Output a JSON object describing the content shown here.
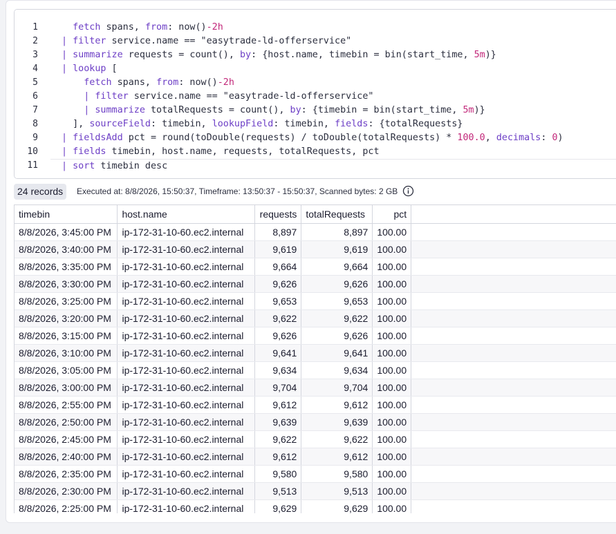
{
  "editor": {
    "lines": [
      {
        "n": "1",
        "tokens": [
          [
            "",
            "  "
          ],
          [
            "kw",
            "fetch"
          ],
          [
            "",
            " spans, "
          ],
          [
            "param",
            "from"
          ],
          [
            "",
            ": now()"
          ],
          [
            "num",
            "-2h"
          ]
        ]
      },
      {
        "n": "2",
        "tokens": [
          [
            "pipe",
            "| "
          ],
          [
            "kw",
            "filter"
          ],
          [
            "",
            " service.name == \"easytrade-ld-offerservice\""
          ]
        ]
      },
      {
        "n": "3",
        "tokens": [
          [
            "pipe",
            "| "
          ],
          [
            "kw",
            "summarize"
          ],
          [
            "",
            " requests = count(), "
          ],
          [
            "param",
            "by"
          ],
          [
            "",
            ": {host.name, timebin = bin(start_time, "
          ],
          [
            "num",
            "5m"
          ],
          [
            "",
            ")}"
          ]
        ]
      },
      {
        "n": "4",
        "tokens": [
          [
            "pipe",
            "| "
          ],
          [
            "kw",
            "lookup"
          ],
          [
            "",
            " ["
          ]
        ]
      },
      {
        "n": "5",
        "tokens": [
          [
            "",
            "    "
          ],
          [
            "kw",
            "fetch"
          ],
          [
            "",
            " spans, "
          ],
          [
            "param",
            "from"
          ],
          [
            "",
            ": now()"
          ],
          [
            "num",
            "-2h"
          ]
        ]
      },
      {
        "n": "6",
        "tokens": [
          [
            "",
            "    "
          ],
          [
            "pipe",
            "| "
          ],
          [
            "kw",
            "filter"
          ],
          [
            "",
            " service.name == \"easytrade-ld-offerservice\""
          ]
        ]
      },
      {
        "n": "7",
        "tokens": [
          [
            "",
            "    "
          ],
          [
            "pipe",
            "| "
          ],
          [
            "kw",
            "summarize"
          ],
          [
            "",
            " totalRequests = count(), "
          ],
          [
            "param",
            "by"
          ],
          [
            "",
            ": {timebin = bin(start_time, "
          ],
          [
            "num",
            "5m"
          ],
          [
            "",
            ")}"
          ]
        ]
      },
      {
        "n": "8",
        "tokens": [
          [
            "",
            "  ], "
          ],
          [
            "param",
            "sourceField"
          ],
          [
            "",
            ": timebin, "
          ],
          [
            "param",
            "lookupField"
          ],
          [
            "",
            ": timebin, "
          ],
          [
            "param",
            "fields"
          ],
          [
            "",
            ": {totalRequests}"
          ]
        ]
      },
      {
        "n": "9",
        "tokens": [
          [
            "pipe",
            "| "
          ],
          [
            "kw",
            "fieldsAdd"
          ],
          [
            "",
            " pct = round(toDouble(requests) / toDouble(totalRequests) * "
          ],
          [
            "num",
            "100.0"
          ],
          [
            "",
            ", "
          ],
          [
            "param",
            "decimals"
          ],
          [
            "",
            ": "
          ],
          [
            "num",
            "0"
          ],
          [
            "",
            ")"
          ]
        ]
      },
      {
        "n": "10",
        "tokens": [
          [
            "pipe",
            "| "
          ],
          [
            "kw",
            "fields"
          ],
          [
            "",
            " timebin, host.name, requests, totalRequests, pct"
          ]
        ]
      },
      {
        "n": "11",
        "tokens": [
          [
            "pipe",
            "| "
          ],
          [
            "kw",
            "sort"
          ],
          [
            "",
            " timebin desc"
          ]
        ]
      }
    ]
  },
  "status": {
    "records": "24 records",
    "meta": "Executed at: 8/8/2026, 15:50:37, Timeframe: 13:50:37 - 15:50:37, Scanned bytes: 2 GB",
    "info_icon": "info-icon"
  },
  "table": {
    "columns": [
      "timebin",
      "host.name",
      "requests",
      "totalRequests",
      "pct"
    ],
    "rows": [
      [
        "8/8/2026, 3:45:00 PM",
        "ip-172-31-10-60.ec2.internal",
        "8,897",
        "8,897",
        "100.00"
      ],
      [
        "8/8/2026, 3:40:00 PM",
        "ip-172-31-10-60.ec2.internal",
        "9,619",
        "9,619",
        "100.00"
      ],
      [
        "8/8/2026, 3:35:00 PM",
        "ip-172-31-10-60.ec2.internal",
        "9,664",
        "9,664",
        "100.00"
      ],
      [
        "8/8/2026, 3:30:00 PM",
        "ip-172-31-10-60.ec2.internal",
        "9,626",
        "9,626",
        "100.00"
      ],
      [
        "8/8/2026, 3:25:00 PM",
        "ip-172-31-10-60.ec2.internal",
        "9,653",
        "9,653",
        "100.00"
      ],
      [
        "8/8/2026, 3:20:00 PM",
        "ip-172-31-10-60.ec2.internal",
        "9,622",
        "9,622",
        "100.00"
      ],
      [
        "8/8/2026, 3:15:00 PM",
        "ip-172-31-10-60.ec2.internal",
        "9,626",
        "9,626",
        "100.00"
      ],
      [
        "8/8/2026, 3:10:00 PM",
        "ip-172-31-10-60.ec2.internal",
        "9,641",
        "9,641",
        "100.00"
      ],
      [
        "8/8/2026, 3:05:00 PM",
        "ip-172-31-10-60.ec2.internal",
        "9,634",
        "9,634",
        "100.00"
      ],
      [
        "8/8/2026, 3:00:00 PM",
        "ip-172-31-10-60.ec2.internal",
        "9,704",
        "9,704",
        "100.00"
      ],
      [
        "8/8/2026, 2:55:00 PM",
        "ip-172-31-10-60.ec2.internal",
        "9,612",
        "9,612",
        "100.00"
      ],
      [
        "8/8/2026, 2:50:00 PM",
        "ip-172-31-10-60.ec2.internal",
        "9,639",
        "9,639",
        "100.00"
      ],
      [
        "8/8/2026, 2:45:00 PM",
        "ip-172-31-10-60.ec2.internal",
        "9,622",
        "9,622",
        "100.00"
      ],
      [
        "8/8/2026, 2:40:00 PM",
        "ip-172-31-10-60.ec2.internal",
        "9,612",
        "9,612",
        "100.00"
      ],
      [
        "8/8/2026, 2:35:00 PM",
        "ip-172-31-10-60.ec2.internal",
        "9,580",
        "9,580",
        "100.00"
      ],
      [
        "8/8/2026, 2:30:00 PM",
        "ip-172-31-10-60.ec2.internal",
        "9,513",
        "9,513",
        "100.00"
      ],
      [
        "8/8/2026, 2:25:00 PM",
        "ip-172-31-10-60.ec2.internal",
        "9,629",
        "9,629",
        "100.00"
      ]
    ]
  },
  "colors": {
    "keyword": "#6d3fc6",
    "number": "#c2287a",
    "text": "#2c2f3f",
    "badge_bg": "#e6e8ee"
  }
}
